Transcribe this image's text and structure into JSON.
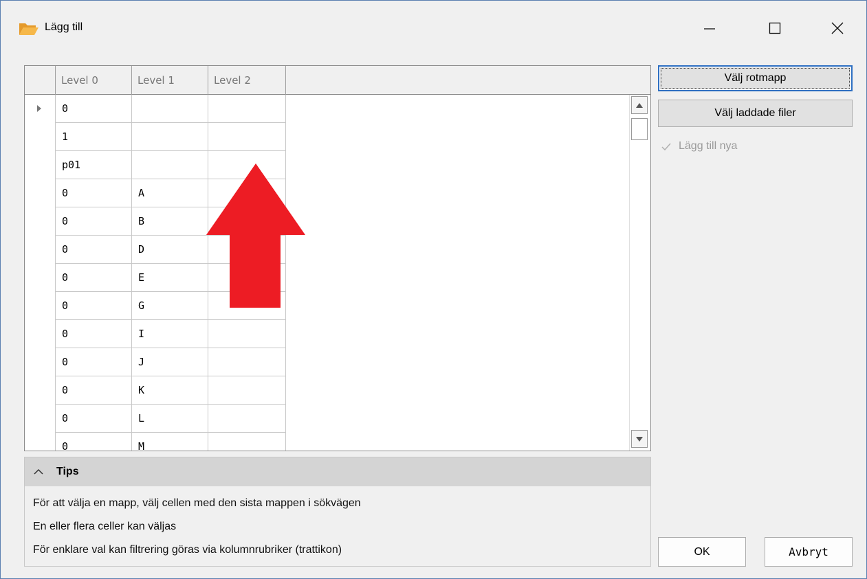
{
  "window": {
    "title": "Lägg till"
  },
  "grid": {
    "columns": [
      "Level 0",
      "Level 1",
      "Level 2"
    ],
    "rows": [
      [
        "0",
        "",
        ""
      ],
      [
        "1",
        "",
        ""
      ],
      [
        "p01",
        "",
        ""
      ],
      [
        "0",
        "A",
        ""
      ],
      [
        "0",
        "B",
        ""
      ],
      [
        "0",
        "D",
        ""
      ],
      [
        "0",
        "E",
        ""
      ],
      [
        "0",
        "G",
        ""
      ],
      [
        "0",
        "I",
        ""
      ],
      [
        "0",
        "J",
        ""
      ],
      [
        "0",
        "K",
        ""
      ],
      [
        "0",
        "L",
        ""
      ],
      [
        "0",
        "M",
        ""
      ]
    ],
    "annotation_color": "#ed1c24"
  },
  "tips": {
    "title": "Tips",
    "lines": [
      "För att välja en mapp, välj cellen med den sista mappen i sökvägen",
      "En eller flera celler kan väljas",
      "För enklare val kan filtrering göras via kolumnrubriker (trattikon)"
    ]
  },
  "actions": {
    "choose_root": "Välj rotmapp",
    "choose_loaded": "Välj laddade filer",
    "add_new_label": "Lägg till nya",
    "add_new_checked": true,
    "ok": "OK",
    "cancel": "Avbryt"
  },
  "colors": {
    "focus_border": "#2e6fc2",
    "folder_icon": "#f0a030"
  }
}
